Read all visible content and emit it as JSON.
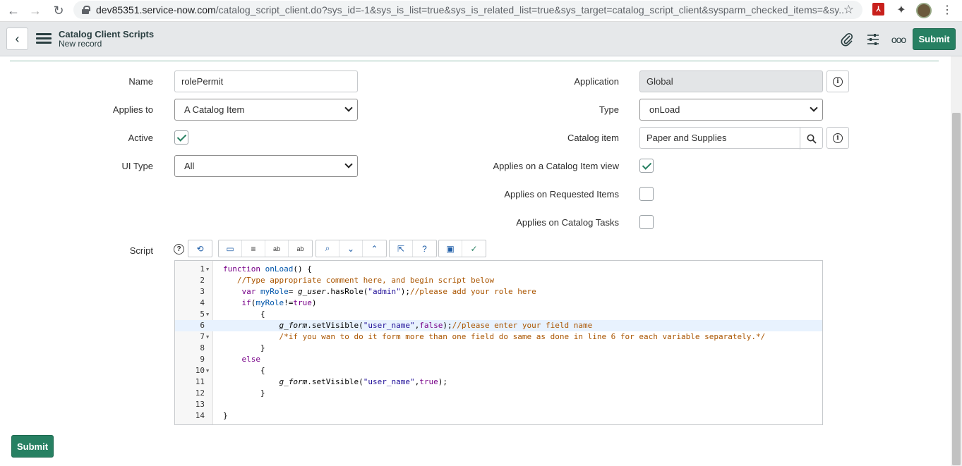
{
  "browser": {
    "url_host": "dev85351.service-now.com",
    "url_path": "/catalog_script_client.do?sys_id=-1&sys_is_list=true&sys_is_related_list=true&sys_target=catalog_script_client&sysparm_checked_items=&sy..."
  },
  "header": {
    "title": "Catalog Client Scripts",
    "subtitle": "New record",
    "submit_label": "Submit"
  },
  "form": {
    "name_label": "Name",
    "name_value": "rolePermit",
    "applies_to_label": "Applies to",
    "applies_to_value": "A Catalog Item",
    "active_label": "Active",
    "ui_type_label": "UI Type",
    "ui_type_value": "All",
    "application_label": "Application",
    "application_value": "Global",
    "type_label": "Type",
    "type_value": "onLoad",
    "catalog_item_label": "Catalog item",
    "catalog_item_value": "Paper and Supplies",
    "applies_catalog_view_label": "Applies on a Catalog Item view",
    "applies_requested_label": "Applies on Requested Items",
    "applies_tasks_label": "Applies on Catalog Tasks",
    "script_label": "Script",
    "active_checked": true,
    "applies_catalog_view_checked": true,
    "applies_requested_checked": false,
    "applies_tasks_checked": false
  },
  "script_lines": [
    "function onLoad() {",
    "   //Type appropriate comment here, and begin script below",
    "    var myRole= g_user.hasRole(\"admin\");//please add your role here",
    "    if(myRole!=true)",
    "        {",
    "            g_form.setVisible(\"user_name\",false);//please enter your field name",
    "            /*if you wan to do it form more than one field do same as done in line 6 for each variable separately.*/",
    "        }",
    "    else",
    "        {",
    "            g_form.setVisible(\"user_name\",true);",
    "        }",
    "",
    "}"
  ],
  "line_numbers": [
    "1",
    "2",
    "3",
    "4",
    "5",
    "6",
    "7",
    "8",
    "9",
    "10",
    "11",
    "12",
    "13",
    "14"
  ],
  "footer": {
    "submit_label": "Submit"
  },
  "colors": {
    "accent": "#278062",
    "header_bg": "#e6e8ea"
  }
}
